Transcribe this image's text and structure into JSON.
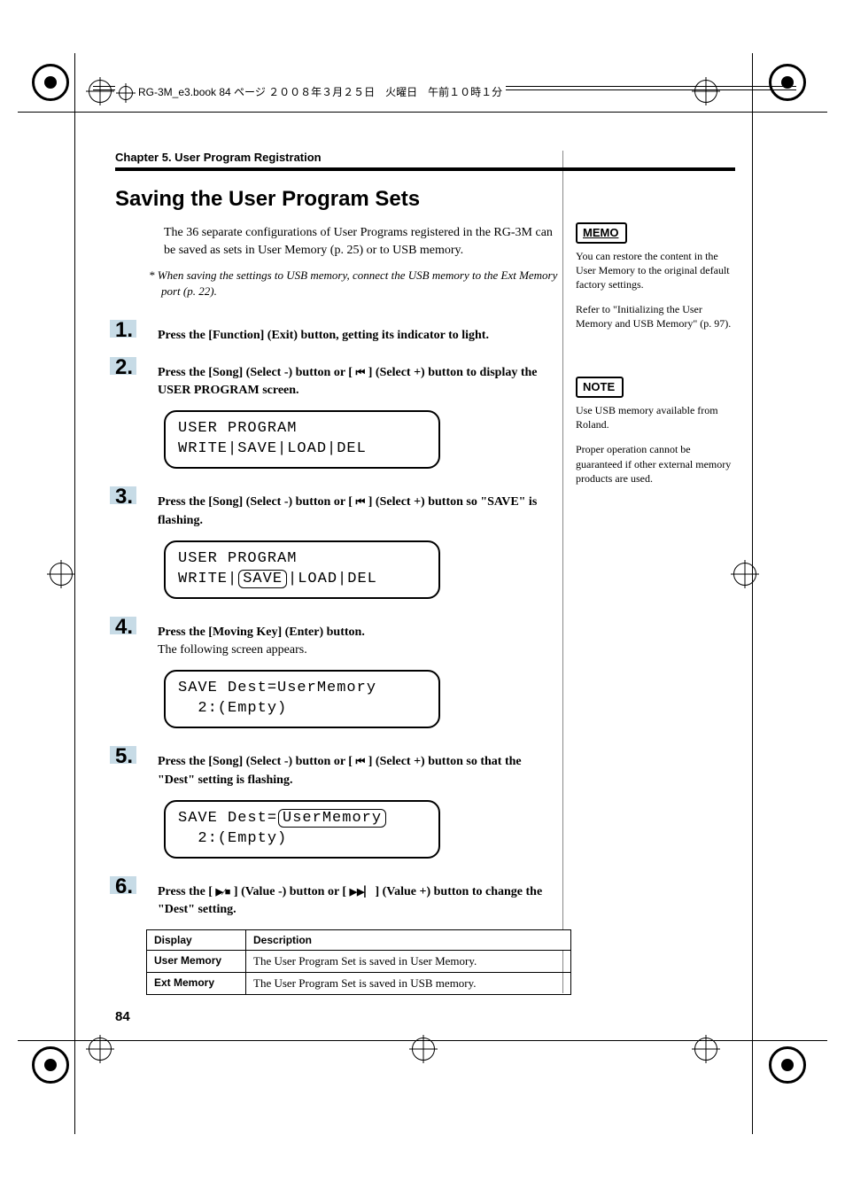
{
  "header_running": "RG-3M_e3.book  84 ページ  ２００８年３月２５日　火曜日　午前１０時１分",
  "chapter_title": "Chapter 5. User Program Registration",
  "section_title": "Saving the User Program Sets",
  "intro": "The 36 separate configurations of User Programs registered in the RG-3M can be saved as sets in User Memory (p. 25) or to USB memory.",
  "asterisk_note": "* When saving the settings to USB memory, connect the USB memory to the Ext Memory port (p. 22).",
  "steps": {
    "1": {
      "text": "Press the [Function] (Exit) button, getting its indicator to light."
    },
    "2": {
      "text_a": "Press the [Song] (Select -) button or [ ",
      "text_b": " ] (Select +) button to display the USER PROGRAM screen.",
      "lcd_l1": "USER PROGRAM",
      "lcd_l2": "WRITE|SAVE|LOAD|DEL"
    },
    "3": {
      "text_a": "Press the [Song] (Select -) button or [ ",
      "text_b": " ] (Select +) button so \"SAVE\" is flashing.",
      "lcd_l1": "USER PROGRAM",
      "lcd_l2_a": "WRITE|",
      "lcd_l2_box": "SAVE",
      "lcd_l2_b": "|LOAD|DEL"
    },
    "4": {
      "text": "Press the [Moving Key] (Enter) button.",
      "subtext": "The following screen appears.",
      "lcd_l1": "SAVE Dest=UserMemory",
      "lcd_l2": "  2:(Empty)"
    },
    "5": {
      "text_a": "Press the [Song] (Select -) button or [ ",
      "text_b": " ] (Select +) button so that the \"Dest\" setting is flashing.",
      "lcd_l1_a": "SAVE Dest=",
      "lcd_l1_box": "UserMemory",
      "lcd_l2": "  2:(Empty)"
    },
    "6": {
      "text_a": "Press the [ ",
      "text_b": " ] (Value -) button or [ ",
      "text_c": " ] (Value +) button to change the \"Dest\" setting."
    }
  },
  "table": {
    "headers": {
      "display": "Display",
      "description": "Description"
    },
    "rows": [
      {
        "display": "User Memory",
        "description": "The User Program Set is saved in User Memory."
      },
      {
        "display": "Ext Memory",
        "description": "The User Program Set is saved in USB memory."
      }
    ]
  },
  "sidebar": {
    "memo_label": "MEMO",
    "memo_text_1": "You can restore the content in the User Memory to the original default factory settings.",
    "memo_text_2": "Refer to \"Initializing the User Memory and USB Memory\" (p. 97).",
    "note_label": "NOTE",
    "note_text_1": "Use USB memory available from Roland.",
    "note_text_2": "Proper operation cannot be guaranteed if other external memory products are used."
  },
  "page_number": "84"
}
